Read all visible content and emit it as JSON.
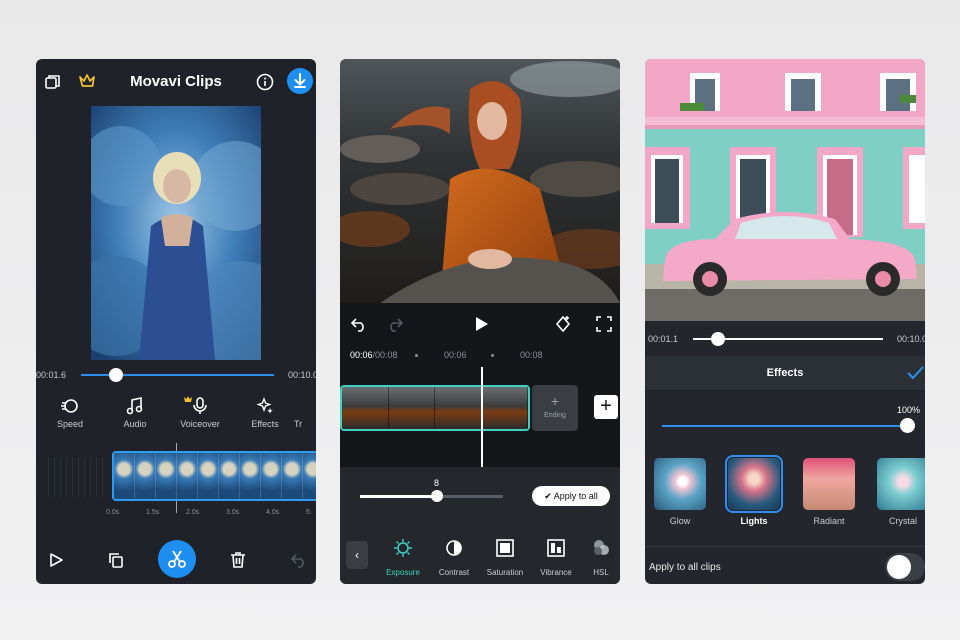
{
  "phone1": {
    "title": "Movavi Clips",
    "time_start": "00:01.6",
    "time_end": "00:10.0",
    "playhead_fraction": 0.19,
    "tools": [
      {
        "icon": "speed-icon",
        "label": "Speed"
      },
      {
        "icon": "audio-icon",
        "label": "Audio"
      },
      {
        "icon": "voiceover-icon",
        "label": "Voiceover",
        "premium": true
      },
      {
        "icon": "effects-icon",
        "label": "Effects"
      },
      {
        "icon": "more-icon",
        "label": "Tr"
      }
    ],
    "ruler": [
      "0.0s",
      "1.5s",
      "2.0s",
      "3.0s",
      "4.0s",
      "5."
    ]
  },
  "phone2": {
    "time_current": "00:06",
    "time_total": "/00:08",
    "time_mid": "00:06",
    "time_right": "00:08",
    "ending_label": "Ending",
    "slider_value": "8",
    "apply_label": "Apply to all",
    "tools": [
      {
        "icon": "exposure-icon",
        "label": "Exposure"
      },
      {
        "icon": "contrast-icon",
        "label": "Contrast"
      },
      {
        "icon": "saturation-icon",
        "label": "Saturation"
      },
      {
        "icon": "vibrance-icon",
        "label": "Vibrance"
      },
      {
        "icon": "hsl-icon",
        "label": "HSL"
      }
    ]
  },
  "phone3": {
    "time_start": "00:01.1",
    "time_end": "00:10.0",
    "panel_title": "Effects",
    "intensity": "100%",
    "effects": [
      {
        "label": "Glow",
        "selected": false
      },
      {
        "label": "Lights",
        "selected": true
      },
      {
        "label": "Radiant",
        "selected": false
      },
      {
        "label": "Crystal",
        "selected": false
      }
    ],
    "apply_all_label": "Apply to all clips"
  },
  "colors": {
    "accent": "#2e8ef0",
    "teal": "#3fd0c1",
    "crown": "#f2c230"
  }
}
